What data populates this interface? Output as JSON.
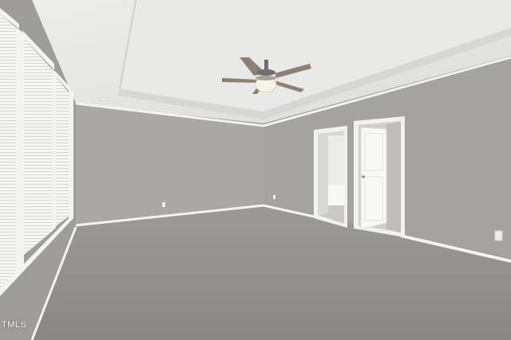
{
  "watermark": {
    "text": "TMLS"
  },
  "colors": {
    "ceiling": "#e4e4e2",
    "wall_back": "#a9a8a6",
    "wall_right": "#a4a3a1",
    "wall_left": "#9e9d9b",
    "carpet": "#8f8d8b",
    "trim": "#f3f3f1"
  },
  "icons": {
    "ceiling_fan": "ceiling-fan-icon",
    "outlet": "outlet-icon"
  }
}
